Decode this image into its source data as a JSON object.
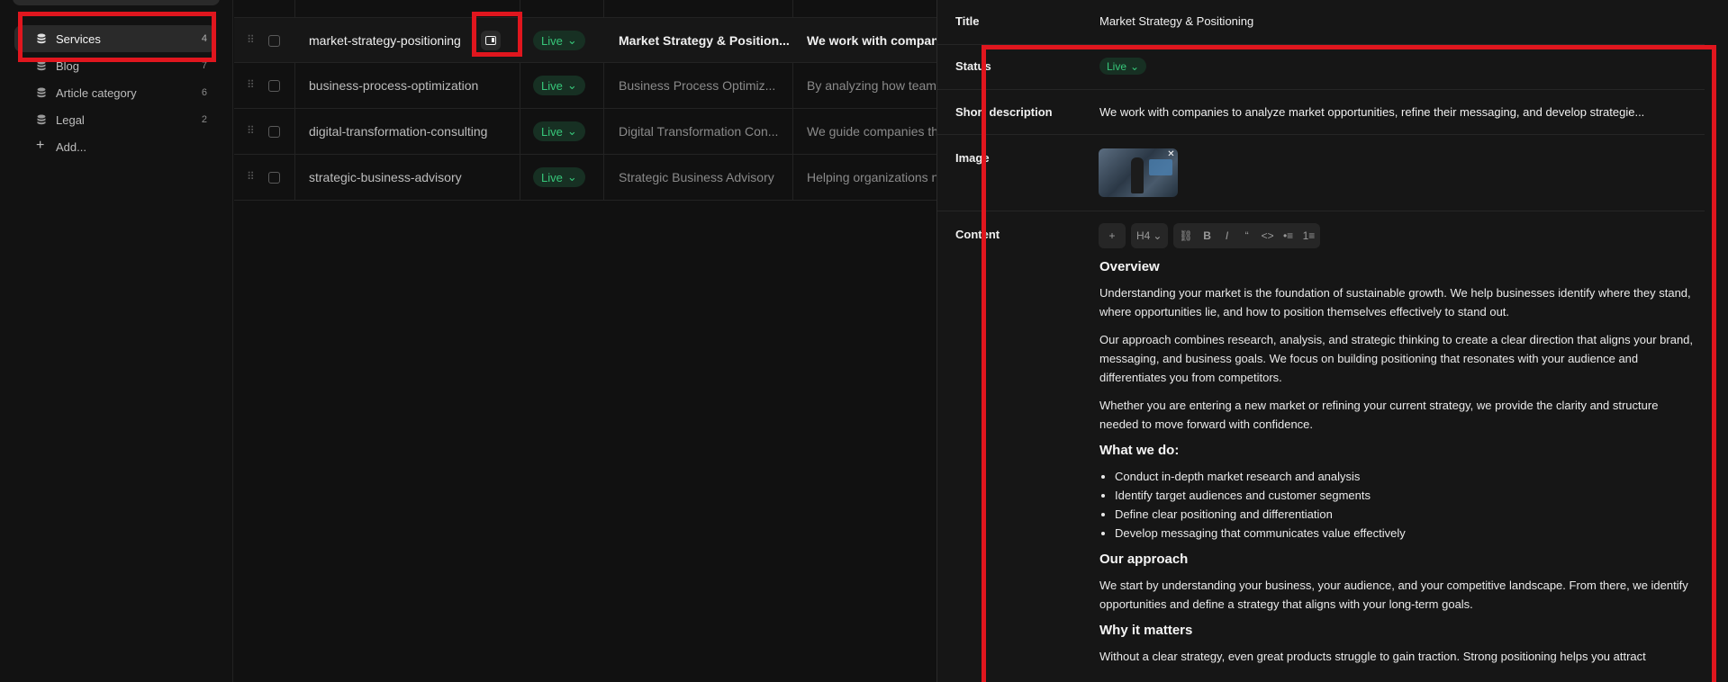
{
  "sidebar": {
    "items": [
      {
        "label": "Services",
        "count": "4"
      },
      {
        "label": "Blog",
        "count": "7"
      },
      {
        "label": "Article category",
        "count": "6"
      },
      {
        "label": "Legal",
        "count": "2"
      }
    ],
    "add_label": "Add..."
  },
  "table": {
    "rows": [
      {
        "slug": "market-strategy-positioning",
        "status": "Live",
        "title": "Market Strategy & Position...",
        "desc": "We work with companies to analyze"
      },
      {
        "slug": "business-process-optimization",
        "status": "Live",
        "title": "Business Process Optimiz...",
        "desc": "By analyzing how teams"
      },
      {
        "slug": "digital-transformation-consulting",
        "status": "Live",
        "title": "Digital Transformation Con...",
        "desc": "We guide companies th"
      },
      {
        "slug": "strategic-business-advisory",
        "status": "Live",
        "title": "Strategic Business Advisory",
        "desc": "Helping organizations n"
      }
    ]
  },
  "panel": {
    "title_label": "Title",
    "title_value": "Market Strategy & Positioning",
    "status_label": "Status",
    "status_value": "Live",
    "short_desc_label": "Short description",
    "short_desc_value": "We work with companies to analyze market opportunities, refine their messaging, and develop strategie...",
    "image_label": "Image",
    "content_label": "Content",
    "toolbar": {
      "plus": "+",
      "heading": "H4",
      "bold": "B",
      "italic": "I",
      "quote": "“",
      "code": "<>",
      "bullets": "•≡",
      "numbers": "1≡"
    },
    "content": {
      "h_overview": "Overview",
      "p1": "Understanding your market is the foundation of sustainable growth. We help businesses identify where they stand, where opportunities lie, and how to position themselves effectively to stand out.",
      "p2": "Our approach combines research, analysis, and strategic thinking to create a clear direction that aligns your brand, messaging, and business goals. We focus on building positioning that resonates with your audience and differentiates you from competitors.",
      "p3": "Whether you are entering a new market or refining your current strategy, we provide the clarity and structure needed to move forward with confidence.",
      "h_what": "What we do:",
      "bullets": [
        "Conduct in-depth market research and analysis",
        "Identify target audiences and customer segments",
        "Define clear positioning and differentiation",
        "Develop messaging that communicates value effectively"
      ],
      "h_approach": "Our approach",
      "p4": "We start by understanding your business, your audience, and your competitive landscape. From there, we identify opportunities and define a strategy that aligns with your long-term goals.",
      "h_why": "Why it matters",
      "p5": "Without a clear strategy, even great products struggle to gain traction. Strong positioning helps you attract"
    }
  },
  "colors": {
    "accent_live": "#37c77a",
    "annotation_red": "#e0161e"
  }
}
